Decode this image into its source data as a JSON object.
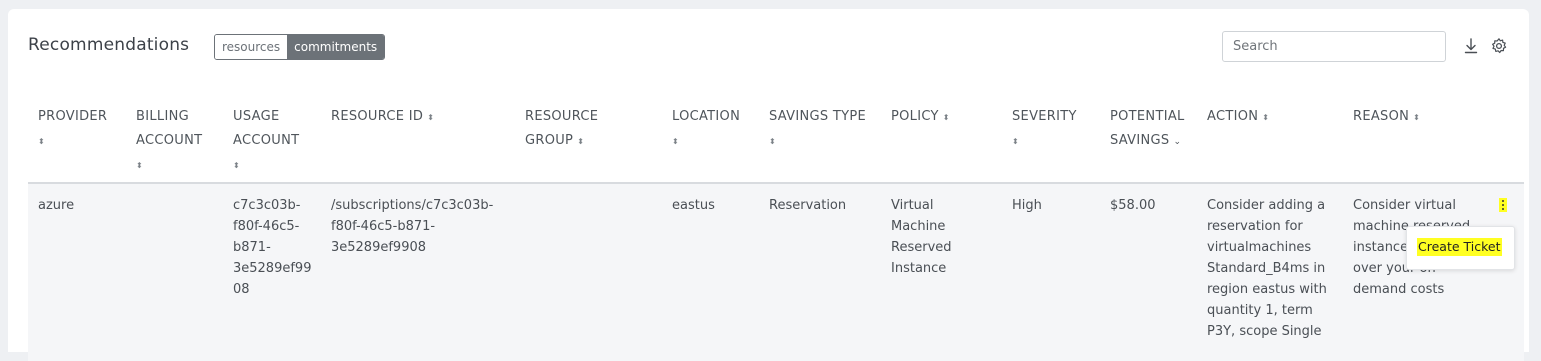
{
  "header": {
    "title": "Recommendations",
    "toggle": [
      "resources",
      "commitments"
    ],
    "toggle_active": "commitments",
    "search_placeholder": "Search"
  },
  "icons": {
    "download": "download-icon",
    "settings": "gear-icon"
  },
  "columns": {
    "provider": [
      "PROVIDER"
    ],
    "billing_account": [
      "BILLING",
      "ACCOUNT"
    ],
    "usage_account": [
      "USAGE",
      "ACCOUNT"
    ],
    "resource_id": [
      "RESOURCE ID"
    ],
    "resource_group": [
      "RESOURCE",
      "GROUP"
    ],
    "location": [
      "LOCATION"
    ],
    "savings_type": [
      "SAVINGS TYPE"
    ],
    "policy": [
      "POLICY"
    ],
    "severity": [
      "SEVERITY"
    ],
    "potential_savings": [
      "POTENTIAL",
      "SAVINGS"
    ],
    "action": [
      "ACTION"
    ],
    "reason": [
      "REASON"
    ]
  },
  "row": {
    "provider": "azure",
    "billing_account": "",
    "usage_account": [
      "c7c3c03b-",
      "f80f-46c5-",
      "b871-",
      "3e5289ef99",
      "08"
    ],
    "resource_id": [
      "/subscriptions/c7c3c03b-",
      "f80f-46c5-b871-",
      "3e5289ef9908"
    ],
    "resource_group": "",
    "location": "eastus",
    "savings_type": "Reservation",
    "policy": [
      "Virtual",
      "Machine",
      "Reserved",
      "Instance"
    ],
    "severity": "High",
    "potential_savings": "$58.00",
    "action": [
      "Consider adding a",
      "reservation for",
      "virtualmachines",
      "Standard_B4ms in",
      "region eastus with",
      "quantity 1, term",
      "P3Y, scope Single"
    ],
    "reason": [
      "Consider virtual",
      "machine reserved",
      "instance",
      "over your on-",
      "demand costs"
    ]
  },
  "menu": {
    "create_ticket": "Create Ticket"
  },
  "colors": {
    "highlight": "#ffff22",
    "toggle_active_bg": "#6c7278"
  }
}
